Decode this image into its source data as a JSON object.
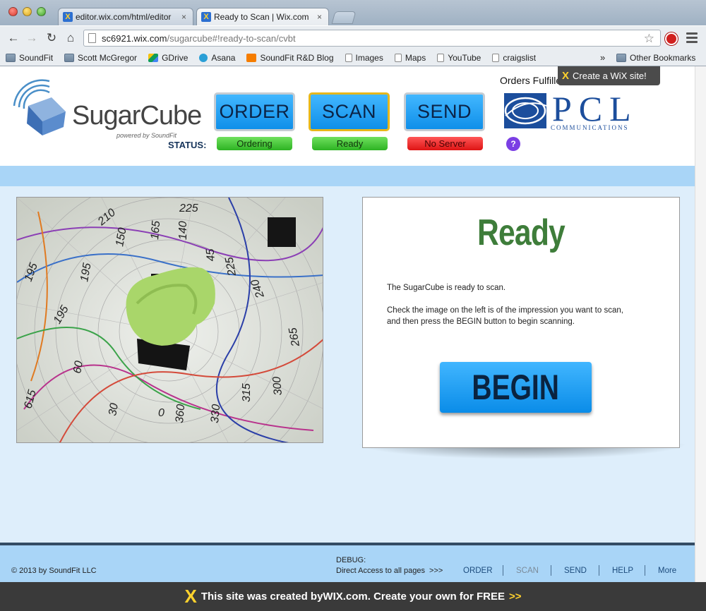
{
  "browser": {
    "tabs": [
      {
        "title": "editor.wix.com/html/editor",
        "close": "×"
      },
      {
        "title": "Ready to Scan | Wix.com",
        "close": "×"
      }
    ],
    "url_host": "sc6921.wix.com",
    "url_path": "/sugarcube#!ready-to-scan/cvbt",
    "bookmarks": [
      {
        "label": "SoundFit",
        "icon": "folder-icon"
      },
      {
        "label": "Scott McGregor",
        "icon": "folder-icon"
      },
      {
        "label": "GDrive",
        "icon": "drive-icon"
      },
      {
        "label": "Asana",
        "icon": "asana-icon"
      },
      {
        "label": "SoundFit R&D Blog",
        "icon": "blogger-icon"
      },
      {
        "label": "Images",
        "icon": "page-icon"
      },
      {
        "label": "Maps",
        "icon": "page-icon"
      },
      {
        "label": "YouTube",
        "icon": "page-icon"
      },
      {
        "label": "craigslist",
        "icon": "page-icon"
      }
    ],
    "bookmarks_chevron": "»",
    "other_bookmarks": "Other Bookmarks"
  },
  "header": {
    "logo_text": "SugarCube",
    "logo_sub": "powered by SoundFit",
    "orders_fulfilled": "Orders Fulfilled",
    "wix_badge": "Create a WiX site!",
    "pcl_letters": "PCL",
    "pcl_sub": "COMMUNICATIONS",
    "buttons": {
      "order": "ORDER",
      "scan": "SCAN",
      "send": "SEND"
    },
    "status_label": "STATUS:",
    "status": {
      "ordering": "Ordering",
      "ready": "Ready",
      "no_server": "No Server"
    },
    "help": "?"
  },
  "panel": {
    "title": "Ready",
    "line1": "The SugarCube is ready to scan.",
    "line2": "Check the image on the left is of the impression you want to scan, and then press the BEGIN button to begin scanning.",
    "begin": "BEGIN"
  },
  "footer": {
    "copyright": "© 2013 by SoundFit LLC",
    "debug_label": "DEBUG:",
    "debug_text": "Direct Access to all pages  >>>",
    "nav": {
      "order": "ORDER",
      "scan": "SCAN",
      "send": "SEND",
      "help": "HELP",
      "more": "More"
    }
  },
  "wix_footer": {
    "text_prefix": "This site was created by ",
    "wix": "WIX.com",
    "text_suffix": ". Create your own for FREE",
    "arrow": ">>"
  },
  "colors": {
    "accent_blue": "#0f8fe9",
    "status_green": "#2db323",
    "status_red": "#de1414",
    "ready_green": "#3e7d3a",
    "band_blue": "#a9d5f7"
  }
}
